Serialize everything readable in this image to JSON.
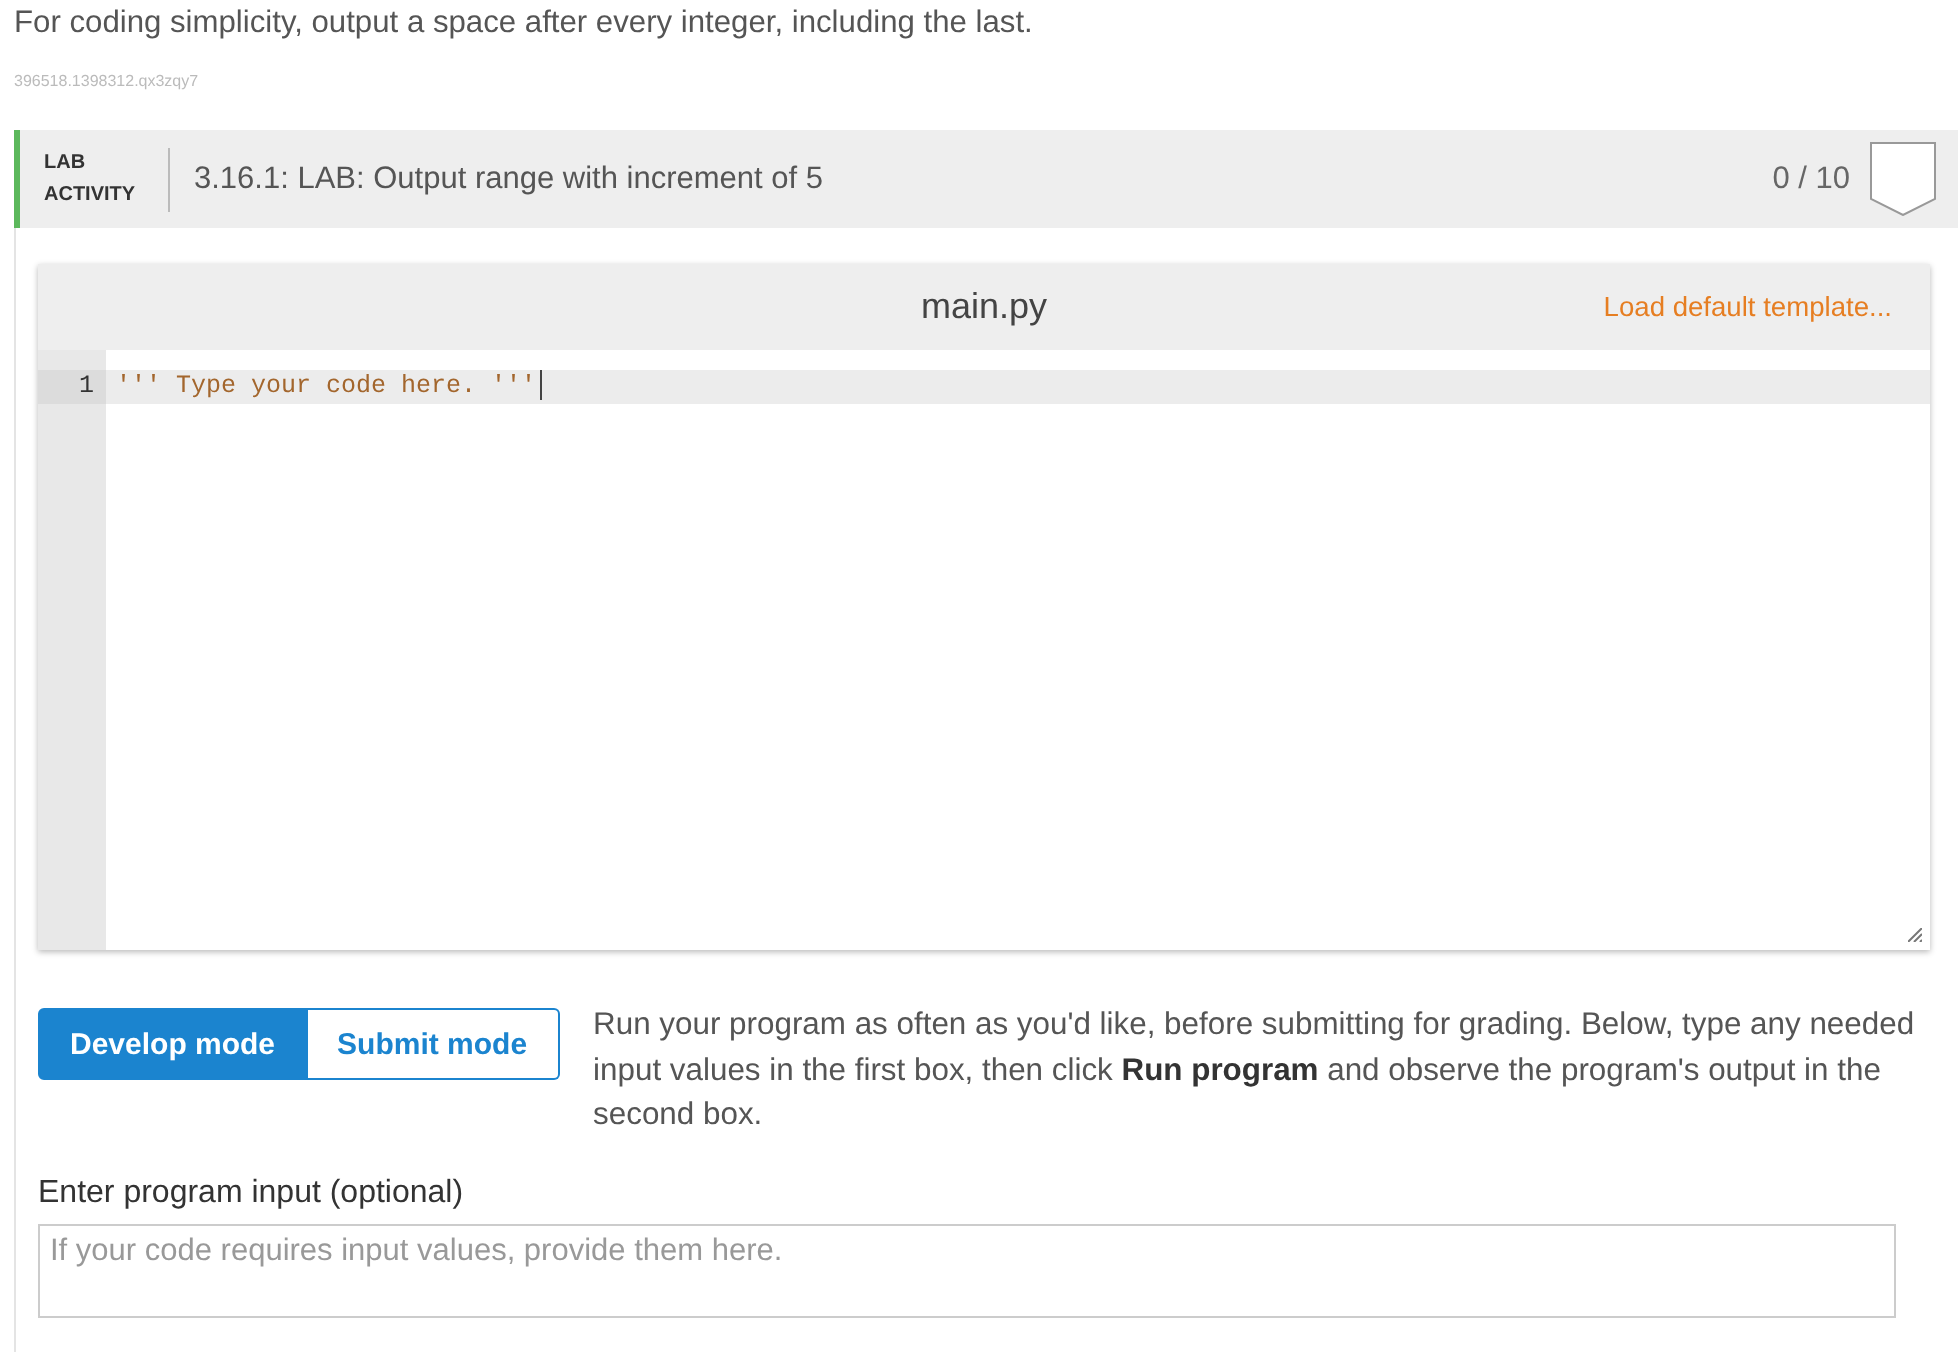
{
  "instructions": {
    "text": "For coding simplicity, output a space after every integer, including the last.",
    "content_id": "396518.1398312.qx3zqy7"
  },
  "activity": {
    "label": "LAB ACTIVITY",
    "title": "3.16.1: LAB: Output range with increment of 5",
    "score": "0 / 10",
    "completed": false
  },
  "editor": {
    "filename": "main.py",
    "template_link": "Load default template...",
    "lines": [
      {
        "number": "1",
        "code": "''' Type your code here. '''",
        "current": true
      }
    ]
  },
  "modes": [
    {
      "label": "Develop mode",
      "selected": true
    },
    {
      "label": "Submit mode",
      "selected": false
    }
  ],
  "mode_help": "Run your program as often as you'd like, before submitting for grading. Below, type any needed input values in the first box, then click **Run program** and observe the program's output in the second box.",
  "program_input": {
    "label": "Enter program input (optional)",
    "placeholder": "If your code requires input values, provide them here."
  }
}
